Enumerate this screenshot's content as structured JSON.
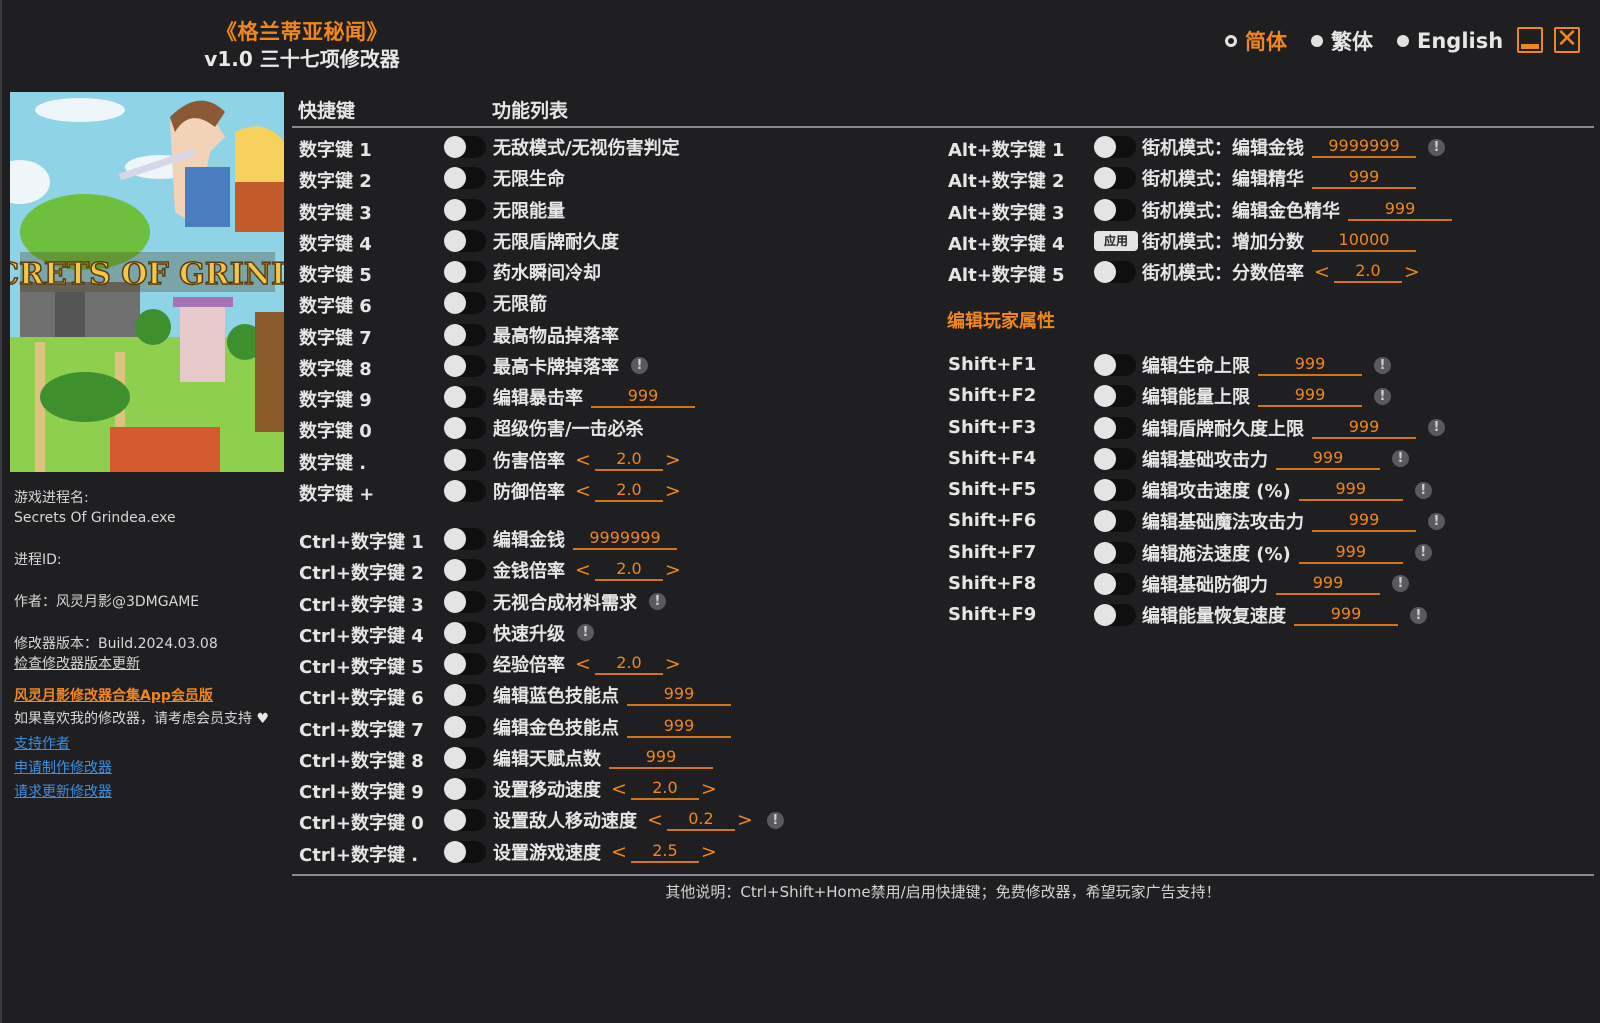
{
  "header": {
    "game_title": "《格兰蒂亚秘闻》",
    "trainer_subtitle": "v1.0 三十七项修改器"
  },
  "languages": [
    {
      "label": "简体",
      "selected": true
    },
    {
      "label": "繁体",
      "selected": false
    },
    {
      "label": "English",
      "selected": false
    }
  ],
  "window_controls": {
    "minimize_icon": "minimize-icon",
    "close_icon": "close-icon",
    "close_glyph": "✕"
  },
  "cover": {
    "title_text": "SECRETS OF GRINDEA"
  },
  "sidebar": {
    "process_label": "游戏进程名:",
    "process_name": "Secrets Of Grindea.exe",
    "pid_label": "进程ID:",
    "author": "作者：风灵月影@3DMGAME",
    "version": "修改器版本：Build.2024.03.08",
    "check_update": "检查修改器版本更新",
    "app_promo": "风灵月影修改器合集App会员版",
    "support_text": "如果喜欢我的修改器，请考虑会员支持",
    "heart": "♥",
    "links": [
      "支持作者",
      "申请制作修改器",
      "请求更新修改器"
    ]
  },
  "list_header": {
    "hotkey": "快捷键",
    "functions": "功能列表"
  },
  "left_rows": [
    {
      "key": "数字键 1",
      "label": "无敌模式/无视伤害判定",
      "control": "toggle"
    },
    {
      "key": "数字键 2",
      "label": "无限生命",
      "control": "toggle"
    },
    {
      "key": "数字键 3",
      "label": "无限能量",
      "control": "toggle"
    },
    {
      "key": "数字键 4",
      "label": "无限盾牌耐久度",
      "control": "toggle"
    },
    {
      "key": "数字键 5",
      "label": "药水瞬间冷却",
      "control": "toggle"
    },
    {
      "key": "数字键 6",
      "label": "无限箭",
      "control": "toggle"
    },
    {
      "key": "数字键 7",
      "label": "最高物品掉落率",
      "control": "toggle"
    },
    {
      "key": "数字键 8",
      "label": "最高卡牌掉落率",
      "control": "toggle",
      "info": true
    },
    {
      "key": "数字键 9",
      "label": "编辑暴击率",
      "control": "toggle",
      "value": "999"
    },
    {
      "key": "数字键 0",
      "label": "超级伤害/一击必杀",
      "control": "toggle"
    },
    {
      "key": "数字键 .",
      "label": "伤害倍率",
      "control": "toggle",
      "stepper": "2.0"
    },
    {
      "key": "数字键 +",
      "label": "防御倍率",
      "control": "toggle",
      "stepper": "2.0"
    },
    {
      "key": "Ctrl+数字键 1",
      "label": "编辑金钱",
      "control": "toggle",
      "value": "9999999"
    },
    {
      "key": "Ctrl+数字键 2",
      "label": "金钱倍率",
      "control": "toggle",
      "stepper": "2.0"
    },
    {
      "key": "Ctrl+数字键 3",
      "label": "无视合成材料需求",
      "control": "toggle",
      "info": true
    },
    {
      "key": "Ctrl+数字键 4",
      "label": "快速升级",
      "control": "toggle",
      "info": true
    },
    {
      "key": "Ctrl+数字键 5",
      "label": "经验倍率",
      "control": "toggle",
      "stepper": "2.0"
    },
    {
      "key": "Ctrl+数字键 6",
      "label": "编辑蓝色技能点",
      "control": "toggle",
      "value": "999"
    },
    {
      "key": "Ctrl+数字键 7",
      "label": "编辑金色技能点",
      "control": "toggle",
      "value": "999"
    },
    {
      "key": "Ctrl+数字键 8",
      "label": "编辑天赋点数",
      "control": "toggle",
      "value": "999"
    },
    {
      "key": "Ctrl+数字键 9",
      "label": "设置移动速度",
      "control": "toggle",
      "stepper": "2.0"
    },
    {
      "key": "Ctrl+数字键 0",
      "label": "设置敌人移动速度",
      "control": "toggle",
      "stepper": "0.2",
      "info": true
    },
    {
      "key": "Ctrl+数字键 .",
      "label": "设置游戏速度",
      "control": "toggle",
      "stepper": "2.5"
    }
  ],
  "right_rows": [
    {
      "key": "Alt+数字键 1",
      "label": "街机模式：编辑金钱",
      "control": "toggle",
      "value": "9999999",
      "info": true
    },
    {
      "key": "Alt+数字键 2",
      "label": "街机模式：编辑精华",
      "control": "toggle",
      "value": "999"
    },
    {
      "key": "Alt+数字键 3",
      "label": "街机模式：编辑金色精华",
      "control": "toggle",
      "value": "999"
    },
    {
      "key": "Alt+数字键 4",
      "label": "街机模式：增加分数",
      "control": "apply",
      "apply_label": "应用",
      "value": "10000"
    },
    {
      "key": "Alt+数字键 5",
      "label": "街机模式：分数倍率",
      "control": "toggle",
      "stepper": "2.0"
    }
  ],
  "section_title": "编辑玩家属性",
  "player_rows": [
    {
      "key": "Shift+F1",
      "label": "编辑生命上限",
      "control": "toggle",
      "value": "999",
      "info": true
    },
    {
      "key": "Shift+F2",
      "label": "编辑能量上限",
      "control": "toggle",
      "value": "999",
      "info": true
    },
    {
      "key": "Shift+F3",
      "label": "编辑盾牌耐久度上限",
      "control": "toggle",
      "value": "999",
      "info": true
    },
    {
      "key": "Shift+F4",
      "label": "编辑基础攻击力",
      "control": "toggle",
      "value": "999",
      "info": true
    },
    {
      "key": "Shift+F5",
      "label": "编辑攻击速度 (%)",
      "control": "toggle",
      "value": "999",
      "info": true
    },
    {
      "key": "Shift+F6",
      "label": "编辑基础魔法攻击力",
      "control": "toggle",
      "value": "999",
      "info": true
    },
    {
      "key": "Shift+F7",
      "label": "编辑施法速度 (%)",
      "control": "toggle",
      "value": "999",
      "info": true
    },
    {
      "key": "Shift+F8",
      "label": "编辑基础防御力",
      "control": "toggle",
      "value": "999",
      "info": true
    },
    {
      "key": "Shift+F9",
      "label": "编辑能量恢复速度",
      "control": "toggle",
      "value": "999",
      "info": true
    }
  ],
  "symbols": {
    "left_arrow": "<",
    "right_arrow": ">",
    "info": "!"
  },
  "footer": "其他说明：Ctrl+Shift+Home禁用/启用快捷键；免费修改器，希望玩家广告支持！",
  "colors": {
    "accent": "#f0861e",
    "background": "#1f1f21",
    "link": "#3d8fe0",
    "text": "#e6e6e6"
  }
}
